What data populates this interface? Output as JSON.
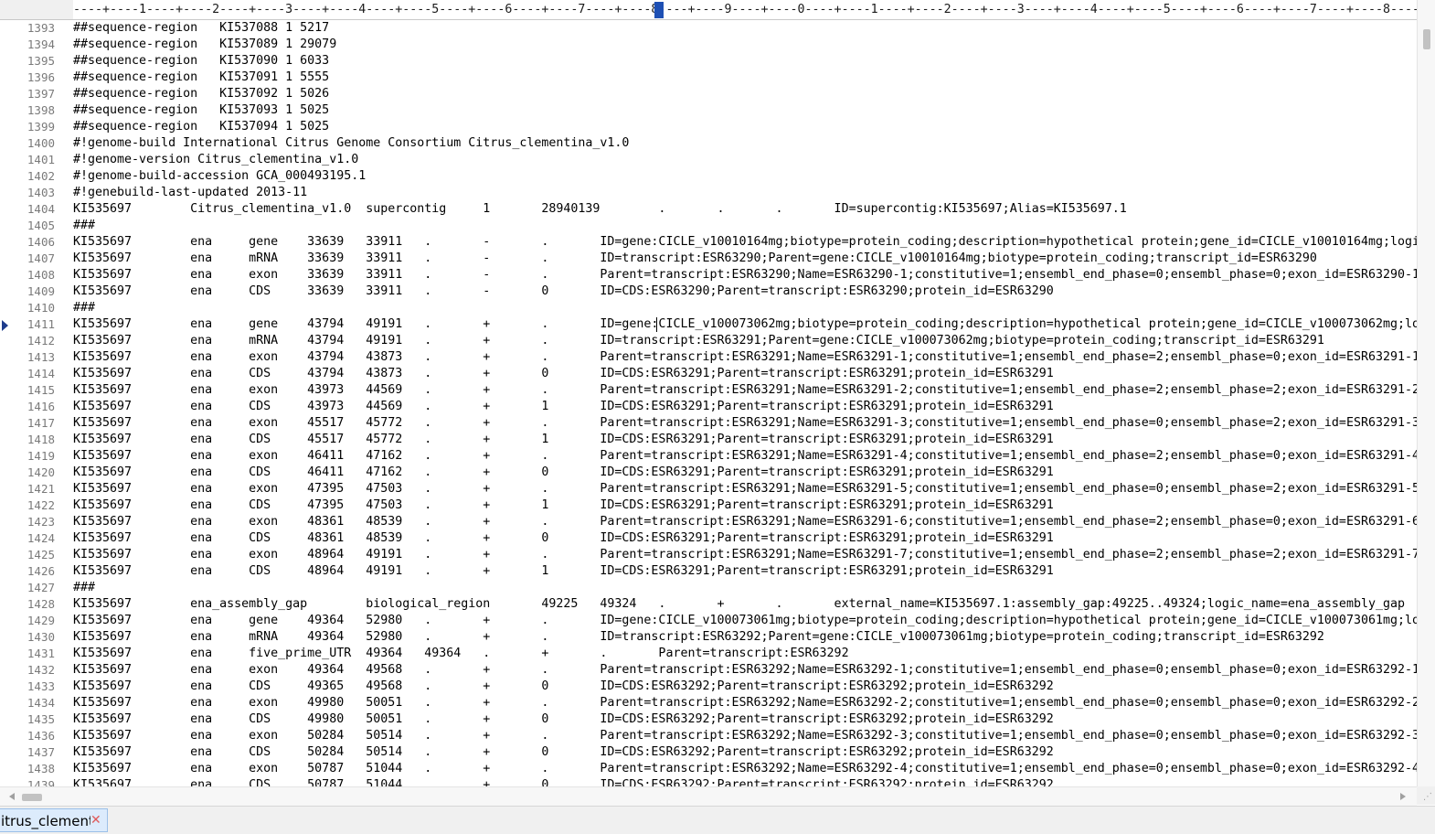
{
  "ruler": {
    "text": "----+----1----+----2----+----3----+----4----+----5----+----6----+----7----+----8----+----9----+----0----+----1----+----2----+----3----+----4----+----5----+----6----+----7----+----8----"
  },
  "caret_line": "1411",
  "lines": [
    {
      "n": "1393",
      "t": "##sequence-region   KI537088 1 5217"
    },
    {
      "n": "1394",
      "t": "##sequence-region   KI537089 1 29079"
    },
    {
      "n": "1395",
      "t": "##sequence-region   KI537090 1 6033"
    },
    {
      "n": "1396",
      "t": "##sequence-region   KI537091 1 5555"
    },
    {
      "n": "1397",
      "t": "##sequence-region   KI537092 1 5026"
    },
    {
      "n": "1398",
      "t": "##sequence-region   KI537093 1 5025"
    },
    {
      "n": "1399",
      "t": "##sequence-region   KI537094 1 5025"
    },
    {
      "n": "1400",
      "t": "#!genome-build International Citrus Genome Consortium Citrus_clementina_v1.0"
    },
    {
      "n": "1401",
      "t": "#!genome-version Citrus_clementina_v1.0"
    },
    {
      "n": "1402",
      "t": "#!genome-build-accession GCA_000493195.1"
    },
    {
      "n": "1403",
      "t": "#!genebuild-last-updated 2013-11"
    },
    {
      "n": "1404",
      "t": "KI535697        Citrus_clementina_v1.0  supercontig     1       28940139        .       .       .       ID=supercontig:KI535697;Alias=KI535697.1"
    },
    {
      "n": "1405",
      "t": "###"
    },
    {
      "n": "1406",
      "t": "KI535697        ena     gene    33639   33911   .       -       .       ID=gene:CICLE_v10010164mg;biotype=protein_coding;description=hypothetical protein;gene_id=CICLE_v10010164mg;logi"
    },
    {
      "n": "1407",
      "t": "KI535697        ena     mRNA    33639   33911   .       -       .       ID=transcript:ESR63290;Parent=gene:CICLE_v10010164mg;biotype=protein_coding;transcript_id=ESR63290"
    },
    {
      "n": "1408",
      "t": "KI535697        ena     exon    33639   33911   .       -       .       Parent=transcript:ESR63290;Name=ESR63290-1;constitutive=1;ensembl_end_phase=0;ensembl_phase=0;exon_id=ESR63290-1"
    },
    {
      "n": "1409",
      "t": "KI535697        ena     CDS     33639   33911   .       -       0       ID=CDS:ESR63290;Parent=transcript:ESR63290;protein_id=ESR63290"
    },
    {
      "n": "1410",
      "t": "###"
    },
    {
      "n": "1411",
      "t": "KI535697        ena     gene    43794   49191   .       +       .       ID=gene:CICLE_v100073062mg;biotype=protein_coding;description=hypothetical protein;gene_id=CICLE_v100073062mg;lo"
    },
    {
      "n": "1412",
      "t": "KI535697        ena     mRNA    43794   49191   .       +       .       ID=transcript:ESR63291;Parent=gene:CICLE_v100073062mg;biotype=protein_coding;transcript_id=ESR63291"
    },
    {
      "n": "1413",
      "t": "KI535697        ena     exon    43794   43873   .       +       .       Parent=transcript:ESR63291;Name=ESR63291-1;constitutive=1;ensembl_end_phase=2;ensembl_phase=0;exon_id=ESR63291-1"
    },
    {
      "n": "1414",
      "t": "KI535697        ena     CDS     43794   43873   .       +       0       ID=CDS:ESR63291;Parent=transcript:ESR63291;protein_id=ESR63291"
    },
    {
      "n": "1415",
      "t": "KI535697        ena     exon    43973   44569   .       +       .       Parent=transcript:ESR63291;Name=ESR63291-2;constitutive=1;ensembl_end_phase=2;ensembl_phase=2;exon_id=ESR63291-2"
    },
    {
      "n": "1416",
      "t": "KI535697        ena     CDS     43973   44569   .       +       1       ID=CDS:ESR63291;Parent=transcript:ESR63291;protein_id=ESR63291"
    },
    {
      "n": "1417",
      "t": "KI535697        ena     exon    45517   45772   .       +       .       Parent=transcript:ESR63291;Name=ESR63291-3;constitutive=1;ensembl_end_phase=0;ensembl_phase=2;exon_id=ESR63291-3"
    },
    {
      "n": "1418",
      "t": "KI535697        ena     CDS     45517   45772   .       +       1       ID=CDS:ESR63291;Parent=transcript:ESR63291;protein_id=ESR63291"
    },
    {
      "n": "1419",
      "t": "KI535697        ena     exon    46411   47162   .       +       .       Parent=transcript:ESR63291;Name=ESR63291-4;constitutive=1;ensembl_end_phase=2;ensembl_phase=0;exon_id=ESR63291-4"
    },
    {
      "n": "1420",
      "t": "KI535697        ena     CDS     46411   47162   .       +       0       ID=CDS:ESR63291;Parent=transcript:ESR63291;protein_id=ESR63291"
    },
    {
      "n": "1421",
      "t": "KI535697        ena     exon    47395   47503   .       +       .       Parent=transcript:ESR63291;Name=ESR63291-5;constitutive=1;ensembl_end_phase=0;ensembl_phase=2;exon_id=ESR63291-5"
    },
    {
      "n": "1422",
      "t": "KI535697        ena     CDS     47395   47503   .       +       1       ID=CDS:ESR63291;Parent=transcript:ESR63291;protein_id=ESR63291"
    },
    {
      "n": "1423",
      "t": "KI535697        ena     exon    48361   48539   .       +       .       Parent=transcript:ESR63291;Name=ESR63291-6;constitutive=1;ensembl_end_phase=2;ensembl_phase=0;exon_id=ESR63291-6"
    },
    {
      "n": "1424",
      "t": "KI535697        ena     CDS     48361   48539   .       +       0       ID=CDS:ESR63291;Parent=transcript:ESR63291;protein_id=ESR63291"
    },
    {
      "n": "1425",
      "t": "KI535697        ena     exon    48964   49191   .       +       .       Parent=transcript:ESR63291;Name=ESR63291-7;constitutive=1;ensembl_end_phase=2;ensembl_phase=2;exon_id=ESR63291-7"
    },
    {
      "n": "1426",
      "t": "KI535697        ena     CDS     48964   49191   .       +       1       ID=CDS:ESR63291;Parent=transcript:ESR63291;protein_id=ESR63291"
    },
    {
      "n": "1427",
      "t": "###"
    },
    {
      "n": "1428",
      "t": "KI535697        ena_assembly_gap        biological_region       49225   49324   .       +       .       external_name=KI535697.1:assembly_gap:49225..49324;logic_name=ena_assembly_gap"
    },
    {
      "n": "1429",
      "t": "KI535697        ena     gene    49364   52980   .       +       .       ID=gene:CICLE_v100073061mg;biotype=protein_coding;description=hypothetical protein;gene_id=CICLE_v100073061mg;lo"
    },
    {
      "n": "1430",
      "t": "KI535697        ena     mRNA    49364   52980   .       +       .       ID=transcript:ESR63292;Parent=gene:CICLE_v100073061mg;biotype=protein_coding;transcript_id=ESR63292"
    },
    {
      "n": "1431",
      "t": "KI535697        ena     five_prime_UTR  49364   49364   .       +       .       Parent=transcript:ESR63292"
    },
    {
      "n": "1432",
      "t": "KI535697        ena     exon    49364   49568   .       +       .       Parent=transcript:ESR63292;Name=ESR63292-1;constitutive=1;ensembl_end_phase=0;ensembl_phase=0;exon_id=ESR63292-1"
    },
    {
      "n": "1433",
      "t": "KI535697        ena     CDS     49365   49568   .       +       0       ID=CDS:ESR63292;Parent=transcript:ESR63292;protein_id=ESR63292"
    },
    {
      "n": "1434",
      "t": "KI535697        ena     exon    49980   50051   .       +       .       Parent=transcript:ESR63292;Name=ESR63292-2;constitutive=1;ensembl_end_phase=0;ensembl_phase=0;exon_id=ESR63292-2"
    },
    {
      "n": "1435",
      "t": "KI535697        ena     CDS     49980   50051   .       +       0       ID=CDS:ESR63292;Parent=transcript:ESR63292;protein_id=ESR63292"
    },
    {
      "n": "1436",
      "t": "KI535697        ena     exon    50284   50514   .       +       .       Parent=transcript:ESR63292;Name=ESR63292-3;constitutive=1;ensembl_end_phase=0;ensembl_phase=0;exon_id=ESR63292-3"
    },
    {
      "n": "1437",
      "t": "KI535697        ena     CDS     50284   50514   .       +       0       ID=CDS:ESR63292;Parent=transcript:ESR63292;protein_id=ESR63292"
    },
    {
      "n": "1438",
      "t": "KI535697        ena     exon    50787   51044   .       +       .       Parent=transcript:ESR63292;Name=ESR63292-4;constitutive=1;ensembl_end_phase=0;ensembl_phase=0;exon_id=ESR63292-4"
    },
    {
      "n": "1439",
      "t": "KI535697        ena     CDS     50787   51044   .       +       0       ID=CDS:ESR63292;Parent=transcript:ESR63292;protein_id=ESR63292"
    }
  ],
  "tab": {
    "label": "itrus_clementi",
    "close_icon": "close-icon"
  },
  "colors": {
    "ruler_marker": "#1e50b4",
    "tab_bg": "#dcebfc",
    "close": "#e05a5a",
    "line_number": "#7a7a7a"
  }
}
